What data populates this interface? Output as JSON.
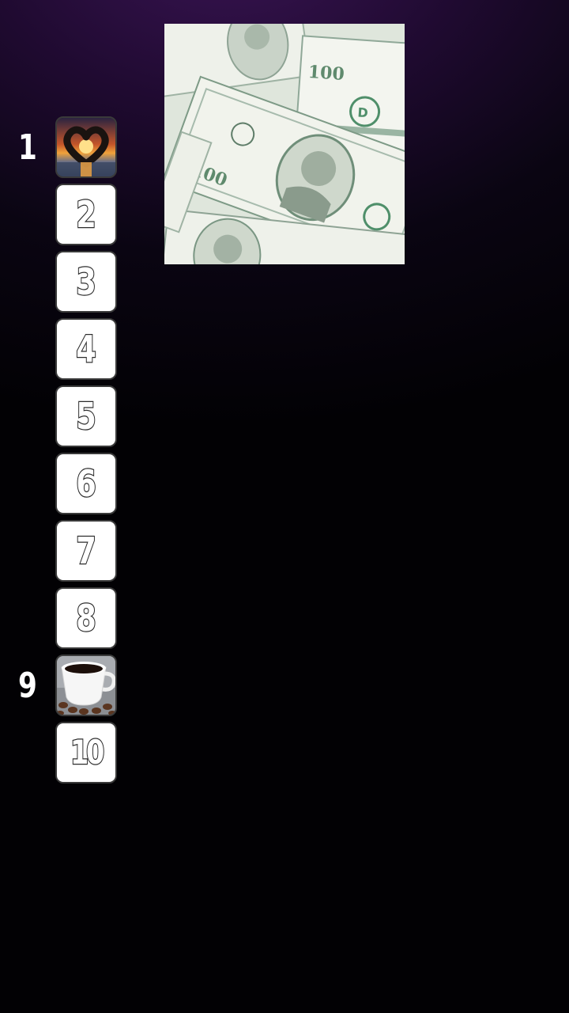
{
  "game": {
    "picture": {
      "icon": "money-dollar-bills-image"
    },
    "slots": [
      {
        "rank": "1",
        "label": "",
        "state": "revealed",
        "icon": "heart-hands-sunset-image",
        "show_rank": true
      },
      {
        "rank": "2",
        "label": "2",
        "state": "hidden",
        "show_rank": false
      },
      {
        "rank": "3",
        "label": "3",
        "state": "hidden",
        "show_rank": false
      },
      {
        "rank": "4",
        "label": "4",
        "state": "hidden",
        "show_rank": false
      },
      {
        "rank": "5",
        "label": "5",
        "state": "hidden",
        "show_rank": false
      },
      {
        "rank": "6",
        "label": "6",
        "state": "hidden",
        "show_rank": false
      },
      {
        "rank": "7",
        "label": "7",
        "state": "hidden",
        "show_rank": false
      },
      {
        "rank": "8",
        "label": "8",
        "state": "hidden",
        "show_rank": false
      },
      {
        "rank": "9",
        "label": "",
        "state": "revealed",
        "icon": "coffee-cup-image",
        "show_rank": true
      },
      {
        "rank": "10",
        "label": "10",
        "state": "hidden",
        "show_rank": false
      }
    ]
  },
  "colors": {
    "background_top": "#3a1454",
    "background_bottom": "#020104",
    "tile_fill": "#ffffff",
    "tile_border": "#3a3a3a",
    "bill_green": "#6f9a7e"
  }
}
